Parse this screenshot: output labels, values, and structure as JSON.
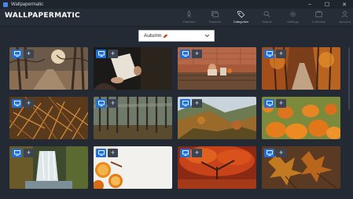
{
  "window": {
    "title": "Wallpapermatic",
    "controls": {
      "minimize": "–",
      "maximize": "☐",
      "close": "✕"
    }
  },
  "header": {
    "logo": "WALLPAPERMATIC",
    "nav": [
      {
        "label": "Featured",
        "icon": "rocket-icon",
        "active": false
      },
      {
        "label": "Random",
        "icon": "images-icon",
        "active": false
      },
      {
        "label": "Categories",
        "icon": "tag-icon",
        "active": true
      },
      {
        "label": "Search",
        "icon": "search-icon",
        "active": false
      },
      {
        "label": "Settings",
        "icon": "gear-icon",
        "active": false
      },
      {
        "label": "Collection",
        "icon": "collection-icon",
        "active": false
      },
      {
        "label": "Account",
        "icon": "user-icon",
        "active": false
      }
    ]
  },
  "category_select": {
    "value": "Autumn",
    "emoji": "🍂"
  },
  "tiles": [
    {
      "subject": "forest-path-with-sun",
      "add_label": "+"
    },
    {
      "subject": "hands-holding-book",
      "add_label": "+"
    },
    {
      "subject": "plush-toy-on-bench",
      "add_label": "+"
    },
    {
      "subject": "autumn-forest-road",
      "add_label": "+"
    },
    {
      "subject": "dry-grass-closeup",
      "add_label": "+"
    },
    {
      "subject": "foggy-birch-forest",
      "add_label": "+"
    },
    {
      "subject": "mountain-valley-autumn",
      "add_label": "+"
    },
    {
      "subject": "pumpkin-patch",
      "add_label": "+"
    },
    {
      "subject": "waterfall-in-forest",
      "add_label": "+"
    },
    {
      "subject": "orange-slices-cinnamon",
      "add_label": "+"
    },
    {
      "subject": "red-maple-tree-park",
      "add_label": "+"
    },
    {
      "subject": "fallen-maple-leaves",
      "add_label": "+"
    }
  ],
  "colors": {
    "accent": "#1e6fd9",
    "background": "#232a33"
  }
}
